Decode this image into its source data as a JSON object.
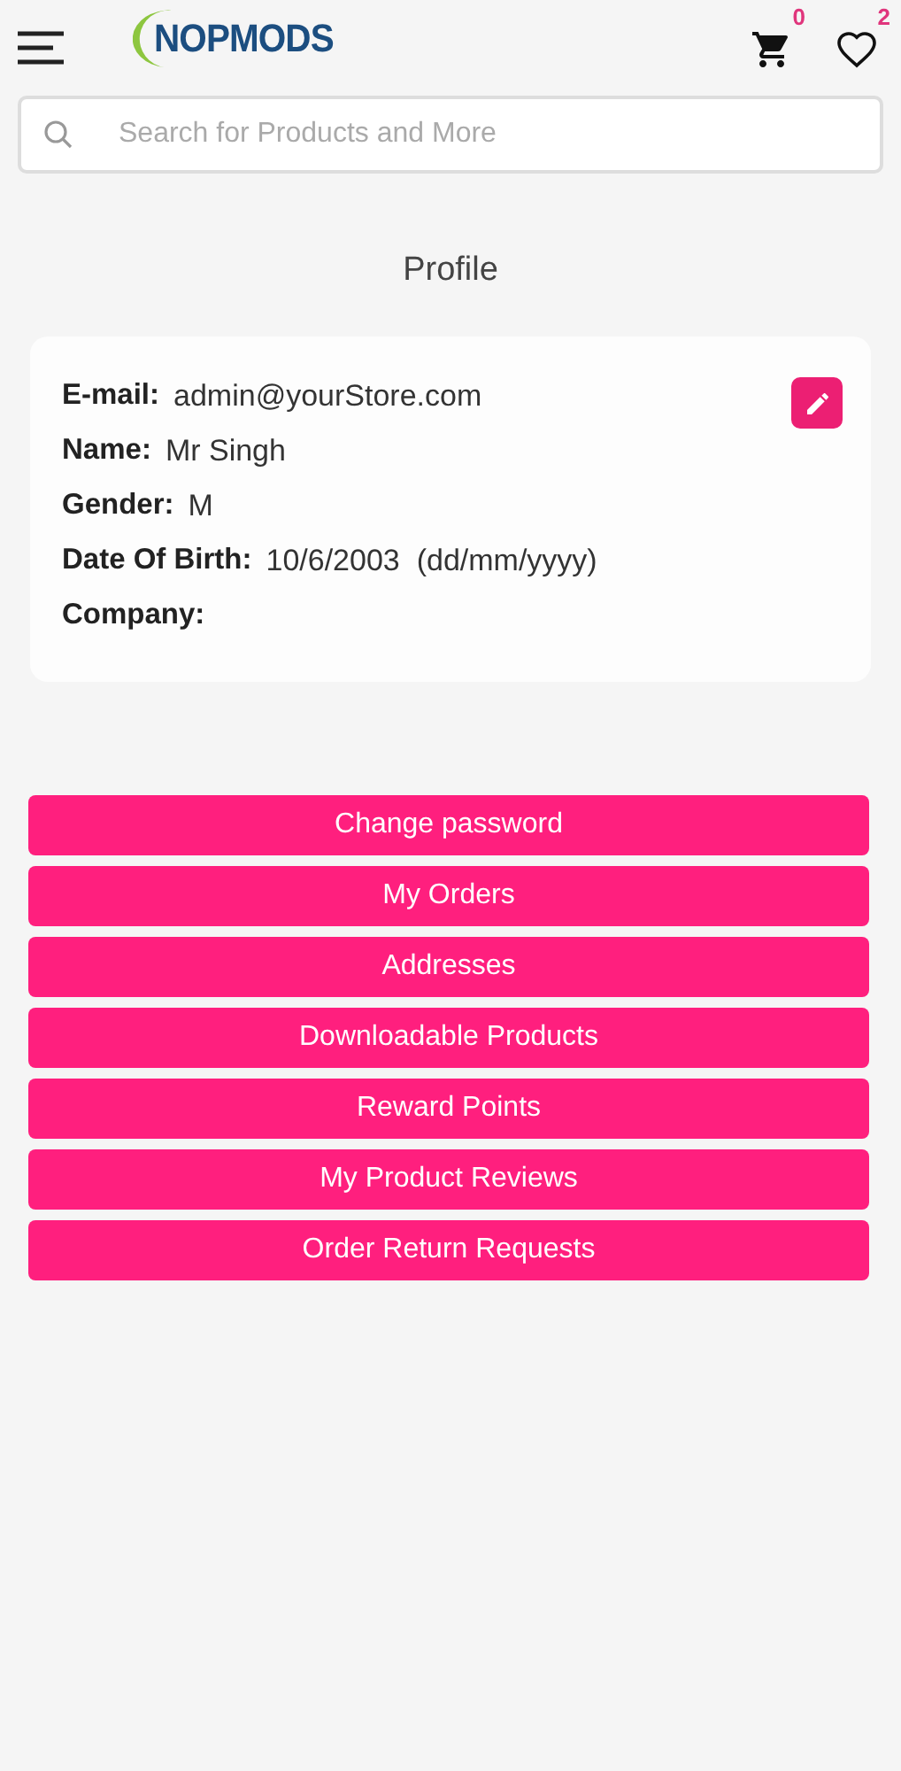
{
  "header": {
    "logo": "NOPMODS",
    "cart_count": "0",
    "wishlist_count": "2"
  },
  "search": {
    "placeholder": "Search for Products and More"
  },
  "page_title": "Profile",
  "profile_fields": [
    {
      "label": "E-mail:",
      "value": "admin@yourStore.com"
    },
    {
      "label": "Name:",
      "value": "Mr Singh"
    },
    {
      "label": "Gender:",
      "value": "M"
    },
    {
      "label": "Date Of Birth:",
      "value": "10/6/2003  (dd/mm/yyyy)"
    },
    {
      "label": "Company:"
    }
  ],
  "menu_buttons": [
    "Change password",
    "My Orders",
    "Addresses",
    "Downloadable Products",
    "Reward Points",
    "My Product Reviews",
    "Order Return Requests"
  ]
}
